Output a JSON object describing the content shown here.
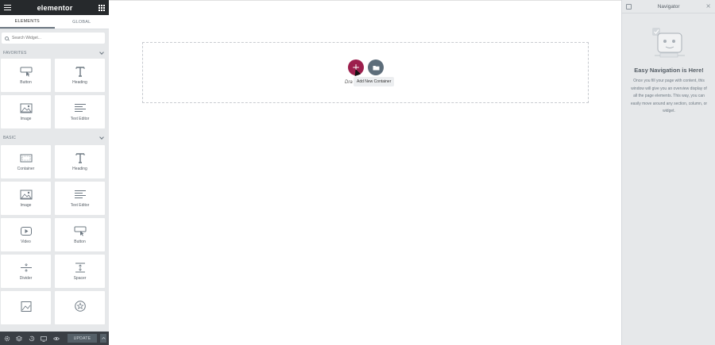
{
  "panel": {
    "logo": "elementor",
    "tabs": [
      "ELEMENTS",
      "GLOBAL"
    ],
    "search_placeholder": "Search Widget...",
    "favorites": {
      "title": "FAVORITES",
      "widgets": [
        {
          "label": "Button",
          "icon": "button-icon"
        },
        {
          "label": "Heading",
          "icon": "heading-icon"
        },
        {
          "label": "Image",
          "icon": "image-icon"
        },
        {
          "label": "Text Editor",
          "icon": "text-editor-icon"
        }
      ]
    },
    "basic": {
      "title": "BASIC",
      "widgets": [
        {
          "label": "Container",
          "icon": "container-icon"
        },
        {
          "label": "Heading",
          "icon": "heading-icon"
        },
        {
          "label": "Image",
          "icon": "image-icon"
        },
        {
          "label": "Text Editor",
          "icon": "text-editor-icon"
        },
        {
          "label": "Video",
          "icon": "video-icon"
        },
        {
          "label": "Button",
          "icon": "button-icon"
        },
        {
          "label": "Divider",
          "icon": "divider-icon"
        },
        {
          "label": "Spacer",
          "icon": "spacer-icon"
        },
        {
          "label": "",
          "icon": "image-box-icon"
        },
        {
          "label": "",
          "icon": "star-icon"
        }
      ]
    },
    "bottom": {
      "update_label": "UPDATE"
    }
  },
  "canvas": {
    "add_button_label": "+",
    "drag_text": "Dra",
    "tooltip": "Add New Container"
  },
  "navigator": {
    "title": "Navigator",
    "empty_title": "Easy Navigation is Here!",
    "empty_text": "Once you fill your page with content, this window will give you an overview display of all the page elements. This way, you can easily move around any section, column, or widget."
  },
  "colors": {
    "topbar": "#26292c",
    "add_button": "#9c1f4d",
    "template_button": "#5d6d7a",
    "panel_bg": "#e6e8ea"
  }
}
